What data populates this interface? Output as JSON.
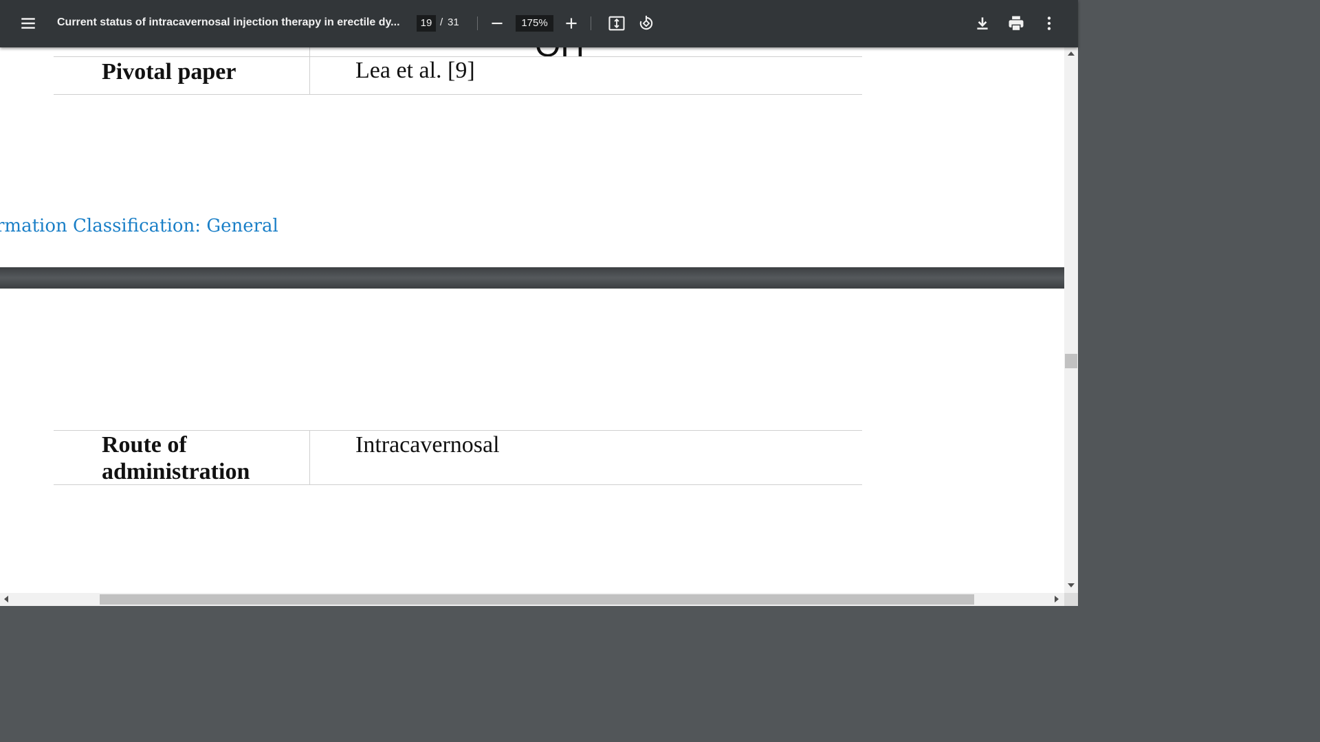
{
  "toolbar": {
    "title": "Current status of intracavernosal injection therapy in erectile dy...",
    "page_current": "19",
    "page_separator": "/",
    "page_total": "31",
    "zoom": "175%",
    "icons": [
      "menu-icon",
      "minus-icon",
      "plus-icon",
      "fit-page-icon",
      "rotate-icon",
      "download-icon",
      "print-icon",
      "more-vert-icon"
    ]
  },
  "document": {
    "partial_text_top": "OH",
    "row1": {
      "label": "Pivotal paper",
      "value": "Lea et al. [9]"
    },
    "classification_text": "rmation Classification: General",
    "row2": {
      "label_line1": "Route of",
      "label_line2": "administration",
      "value": "Intracavernosal"
    }
  },
  "colors": {
    "toolbar_bg": "#323639",
    "viewer_bg": "#525659",
    "classification": "#1a7fc7"
  }
}
